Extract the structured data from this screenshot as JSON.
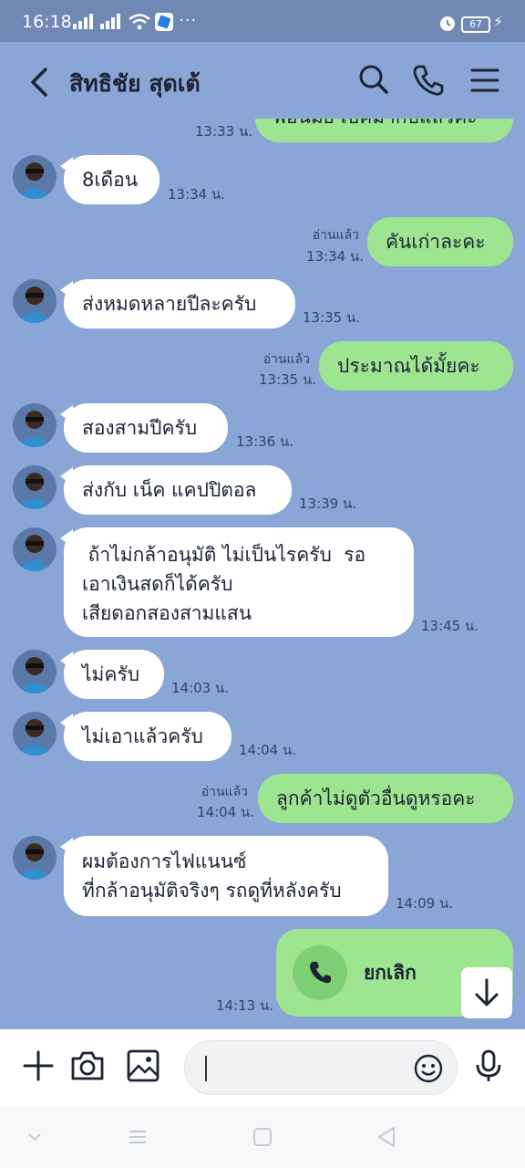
{
  "status": {
    "time": "16:18",
    "dots": "···",
    "battery": "67"
  },
  "header": {
    "contact_name": "สิทธิชัย สุดเต้"
  },
  "messages": [
    {
      "text": "พ้อนมัย เบคม้ากับแล้วคะ",
      "time": "13:33 น."
    },
    {
      "text": "8เดือน",
      "time": "13:34 น."
    },
    {
      "text": "คันเก่าละคะ",
      "time": "13:34 น.",
      "read": "อ่านแล้ว"
    },
    {
      "text": "ส่งหมดหลายปีละครับ",
      "time": "13:35 น."
    },
    {
      "text": "ประมาณได้มั้ยคะ",
      "time": "13:35 น.",
      "read": "อ่านแล้ว"
    },
    {
      "text": "สองสามปีครับ",
      "time": "13:36 น."
    },
    {
      "text": "ส่งกับ เน็ค แคปปิตอล",
      "time": "13:39 น."
    },
    {
      "line1": " ถ้าไม่กล้าอนุมัติ ไม่เป็นไรครับ  รอ",
      "line2": "เอาเงินสดก็ได้ครับ",
      "line3": "เสียดอกสองสามแสน",
      "time": "13:45 น."
    },
    {
      "text": "ไม่ครับ",
      "time": "14:03 น."
    },
    {
      "text": "ไม่เอาแล้วครับ",
      "time": "14:04 น."
    },
    {
      "text": "ลูกค้าไม่ดูตัวอื่นดูหรอคะ",
      "time": "14:04 น.",
      "read": "อ่านแล้ว"
    },
    {
      "line1": "ผมต้องการไฟแนนซ์",
      "line2": "ที่กล้าอนุมัติจริงๆ รถดูที่หลังครับ",
      "time": "14:09 น."
    },
    {
      "call_label": "ยกเลิก",
      "time": "14:13 น."
    }
  ],
  "colors": {
    "chat_bg": "#8aa6d6",
    "outgoing": "#9ee591",
    "incoming": "#ffffff",
    "call_icon_bg": "#7fcf74"
  }
}
